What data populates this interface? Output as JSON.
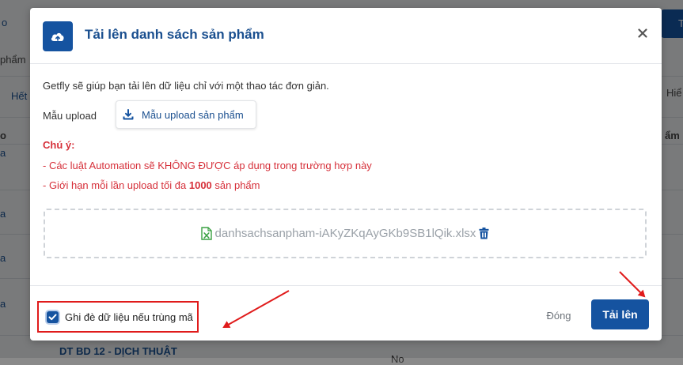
{
  "background": {
    "text_left": [
      "o",
      "phẩm",
      "Hết",
      "o",
      "a",
      "a",
      "a",
      "a"
    ],
    "text_right": [
      "Tả",
      "Hiể",
      "ẩm"
    ],
    "row_label": "DT BD 12 - DỊCH THUẬT",
    "row_value": "No"
  },
  "modal": {
    "title": "Tải lên danh sách sản phẩm",
    "intro": "Getfly sẽ giúp bạn tải lên dữ liệu chỉ với một thao tác đơn giản.",
    "template_label": "Mẫu upload",
    "template_button": "Mẫu upload sản phẩm",
    "note_title": "Chú ý:",
    "note_1": "- Các luật Automation sẽ KHÔNG ĐƯỢC áp dụng trong trường hợp này",
    "note_2_prefix": "- Giới hạn mỗi lần upload tối đa ",
    "note_2_bold": "1000",
    "note_2_suffix": " sản phẩm",
    "file_name": "danhsachsanpham-iAKyZKqAyGKb9SB1lQik.xlsx",
    "overwrite_label": "Ghi đè dữ liệu nếu trùng mã",
    "overwrite_checked": true,
    "close_label": "Đóng",
    "upload_label": "Tải lên"
  },
  "icons": {
    "header": "cloud-upload-icon",
    "close": "close-icon",
    "download": "download-icon",
    "excel": "excel-file-icon",
    "trash": "trash-icon"
  },
  "colors": {
    "primary": "#1553a0",
    "title": "#1a4f8f",
    "warning": "#d6303a",
    "excel": "#3aa142",
    "highlight": "#e01b1b"
  }
}
